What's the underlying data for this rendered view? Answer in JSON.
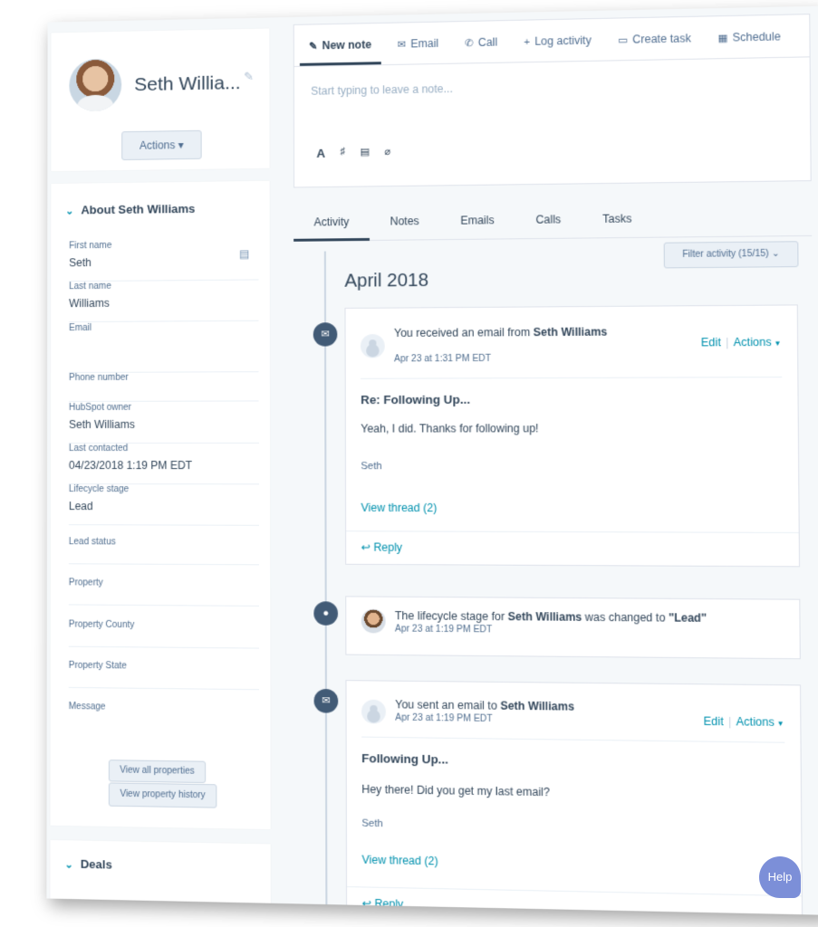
{
  "profile": {
    "name": "Seth Willia...",
    "actions_label": "Actions ▾"
  },
  "about": {
    "header": "About Seth Williams",
    "properties": [
      {
        "label": "First name",
        "value": "Seth"
      },
      {
        "label": "Last name",
        "value": "Williams"
      },
      {
        "label": "Email",
        "value": ""
      },
      {
        "label": "Phone number",
        "value": ""
      },
      {
        "label": "HubSpot owner",
        "value": "Seth Williams"
      },
      {
        "label": "Last contacted",
        "value": "04/23/2018 1:19 PM EDT"
      },
      {
        "label": "Lifecycle stage",
        "value": "Lead"
      },
      {
        "label": "Lead status",
        "value": ""
      },
      {
        "label": "Property",
        "value": ""
      },
      {
        "label": "Property County",
        "value": ""
      },
      {
        "label": "Property State",
        "value": ""
      },
      {
        "label": "Message",
        "value": ""
      }
    ],
    "view_all_label": "View all properties",
    "view_history_label": "View property history"
  },
  "deals": {
    "header": "Deals"
  },
  "composer": {
    "tabs": [
      {
        "label": "New note",
        "icon": "note-icon",
        "glyph": "✎"
      },
      {
        "label": "Email",
        "icon": "email-icon",
        "glyph": "✉"
      },
      {
        "label": "Call",
        "icon": "phone-icon",
        "glyph": "✆"
      },
      {
        "label": "Log activity",
        "icon": "plus-icon",
        "glyph": "+"
      },
      {
        "label": "Create task",
        "icon": "task-icon",
        "glyph": "▭"
      },
      {
        "label": "Schedule",
        "icon": "calendar-icon",
        "glyph": "▦"
      }
    ],
    "placeholder": "Start typing to leave a note...",
    "format_tools": [
      {
        "name": "font-format-icon",
        "glyph": "A"
      },
      {
        "name": "personalize-icon",
        "glyph": "♯"
      },
      {
        "name": "snippet-icon",
        "glyph": "▤"
      },
      {
        "name": "attach-icon",
        "glyph": "⌀"
      }
    ]
  },
  "activity_tabs": [
    "Activity",
    "Notes",
    "Emails",
    "Calls",
    "Tasks"
  ],
  "filter_label": "Filter activity (15/15) ⌄",
  "month": "April 2018",
  "events": {
    "email1": {
      "title_prefix": "You received an email from ",
      "title_name": "Seth Williams",
      "time": "Apr 23 at 1:31 PM EDT",
      "edit": "Edit",
      "actions": "Actions",
      "subject": "Re: Following Up...",
      "body": "Yeah, I did. Thanks for following up!",
      "signature": "Seth",
      "thread": "View thread (2)",
      "reply": "↩ Reply"
    },
    "lifecycle": {
      "title_prefix": "The lifecycle stage for ",
      "title_name": "Seth Williams",
      "title_mid": " was changed to ",
      "title_value": "\"Lead\"",
      "time": "Apr 23 at 1:19 PM EDT"
    },
    "email2": {
      "title_prefix": "You sent an email to ",
      "title_name": "Seth Williams",
      "time": "Apr 23 at 1:19 PM EDT",
      "edit": "Edit",
      "actions": "Actions",
      "subject": "Following Up...",
      "body": "Hey there! Did you get my last email?",
      "signature": "Seth",
      "thread": "View thread (2)",
      "reply": "↩ Reply"
    }
  },
  "help_label": "Help",
  "colors": {
    "accent": "#0091ae",
    "text": "#33475b",
    "timeline_icon": "#425b76",
    "help": "#7c8fd8"
  }
}
